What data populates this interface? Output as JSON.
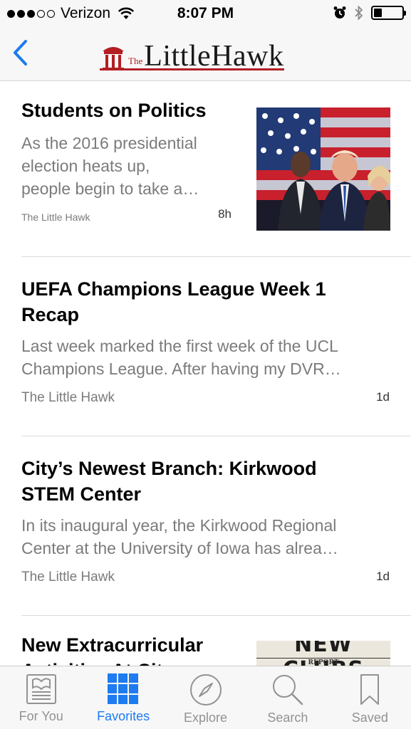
{
  "status_bar": {
    "carrier": "Verizon",
    "time": "8:07 PM",
    "battery_level": 0.3
  },
  "nav": {
    "back_icon": "chevron-left-icon",
    "logo_the": "The",
    "logo_name": "LittleHawk"
  },
  "articles": [
    {
      "headline": "Students on Politics",
      "excerpt_lines": [
        "As the 2016 presidential",
        "election heats up,",
        "people begin to take a…"
      ],
      "source": "The Little Hawk",
      "age": "8h",
      "has_thumbnail": true
    },
    {
      "headline_lines": [
        "UEFA Champions League Week 1",
        "Recap"
      ],
      "excerpt_lines": [
        "Last week marked the first week of the UCL",
        "Champions League. After having my DVR…"
      ],
      "source": "The Little Hawk",
      "age": "1d"
    },
    {
      "headline_lines": [
        "City’s Newest Branch: Kirkwood",
        "STEM Center"
      ],
      "excerpt_lines": [
        "In its inaugural year, the Kirkwood Regional",
        "Center at the University of Iowa has alrea…"
      ],
      "source": "The Little Hawk",
      "age": "1d"
    },
    {
      "headline_lines": [
        "New Extracurricular",
        "Activities At City"
      ],
      "thumb_text": "NEW CLUBS",
      "thumb_subtext": "REPORT"
    }
  ],
  "tabs": [
    {
      "label": "For You",
      "icon": "newspaper-icon",
      "active": false
    },
    {
      "label": "Favorites",
      "icon": "grid-icon",
      "active": true
    },
    {
      "label": "Explore",
      "icon": "compass-icon",
      "active": false
    },
    {
      "label": "Search",
      "icon": "search-icon",
      "active": false
    },
    {
      "label": "Saved",
      "icon": "bookmark-icon",
      "active": false
    }
  ],
  "colors": {
    "accent": "#1e7bf0",
    "brand_red": "#b21e22",
    "secondary_text": "#7b7b7b"
  }
}
